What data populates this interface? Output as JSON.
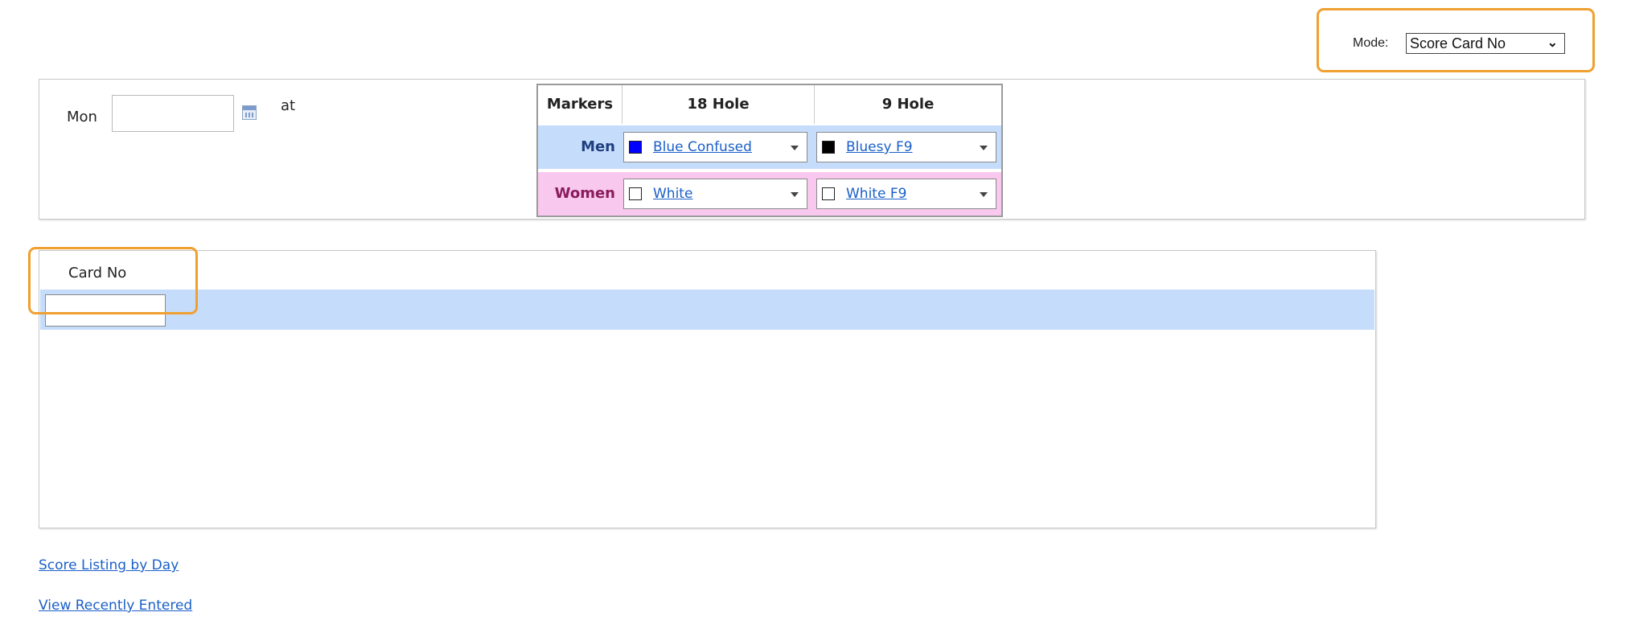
{
  "mode": {
    "label": "Mode:",
    "selected": "Score Card No"
  },
  "date_panel": {
    "day_label": "Mon",
    "date_value": "",
    "at_label": "at"
  },
  "markers": {
    "headers": [
      "Markers",
      "18 Hole",
      "9 Hole"
    ],
    "rows": [
      {
        "label": "Men",
        "color": "#c5dcfb",
        "hole18": {
          "swatch": "#0000ff",
          "text": "Blue Confused"
        },
        "hole9": {
          "swatch": "#000000",
          "text": "Bluesy F9"
        }
      },
      {
        "label": "Women",
        "color": "#f9c8ee",
        "hole18": {
          "swatch": "#ffffff",
          "text": "White"
        },
        "hole9": {
          "swatch": "#ffffff",
          "text": "White F9"
        }
      }
    ]
  },
  "card_table": {
    "header": "Card No",
    "input_value": ""
  },
  "links": {
    "score_listing": "Score Listing by Day",
    "recent": "View Recently Entered"
  },
  "colors": {
    "highlight": "#f0a030",
    "link": "#1a5fc8",
    "row_blue": "#c5dcfb",
    "row_pink": "#f9c8ee"
  }
}
